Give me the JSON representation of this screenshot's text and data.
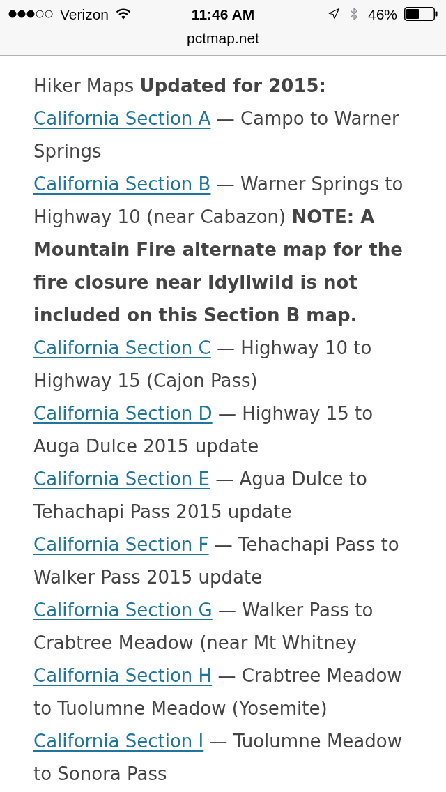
{
  "status_bar": {
    "carrier": "Verizon",
    "time": "11:46 AM",
    "battery": "46%"
  },
  "address_bar": {
    "url": "pctmap.net"
  },
  "content": {
    "intro": "Hiker Maps **Updated for 2015:**",
    "sections": [
      {
        "link": "California Section A",
        "description": "— Campo to Warner Springs"
      },
      {
        "link": "California Section B",
        "description": "— Warner Springs to Highway 10 (near Cabazon) **NOTE: A Mountain Fire alternate map for the fire closure near Idyllwild is not included on this Section B map.**"
      },
      {
        "link": "California Section C",
        "description": "— Highway 10 to Highway 15 (Cajon Pass)"
      },
      {
        "link": "California Section D",
        "description": "— Highway 15 to Auga Dulce 2015 update"
      },
      {
        "link": "California Section E",
        "description": "— Agua Dulce to Tehachapi Pass 2015 update"
      },
      {
        "link": "California Section F",
        "description": "— Tehachapi Pass to Walker Pass 2015 update"
      },
      {
        "link": "California Section G",
        "description": "— Walker Pass to Crabtree Meadow (near Mt Whitney"
      },
      {
        "link": "California Section H",
        "description": "— Crabtree Meadow to Tuolumne Meadow (Yosemite)"
      },
      {
        "link": "California Section I",
        "description": "— Tuolumne Meadow to Sonora Pass"
      }
    ]
  }
}
